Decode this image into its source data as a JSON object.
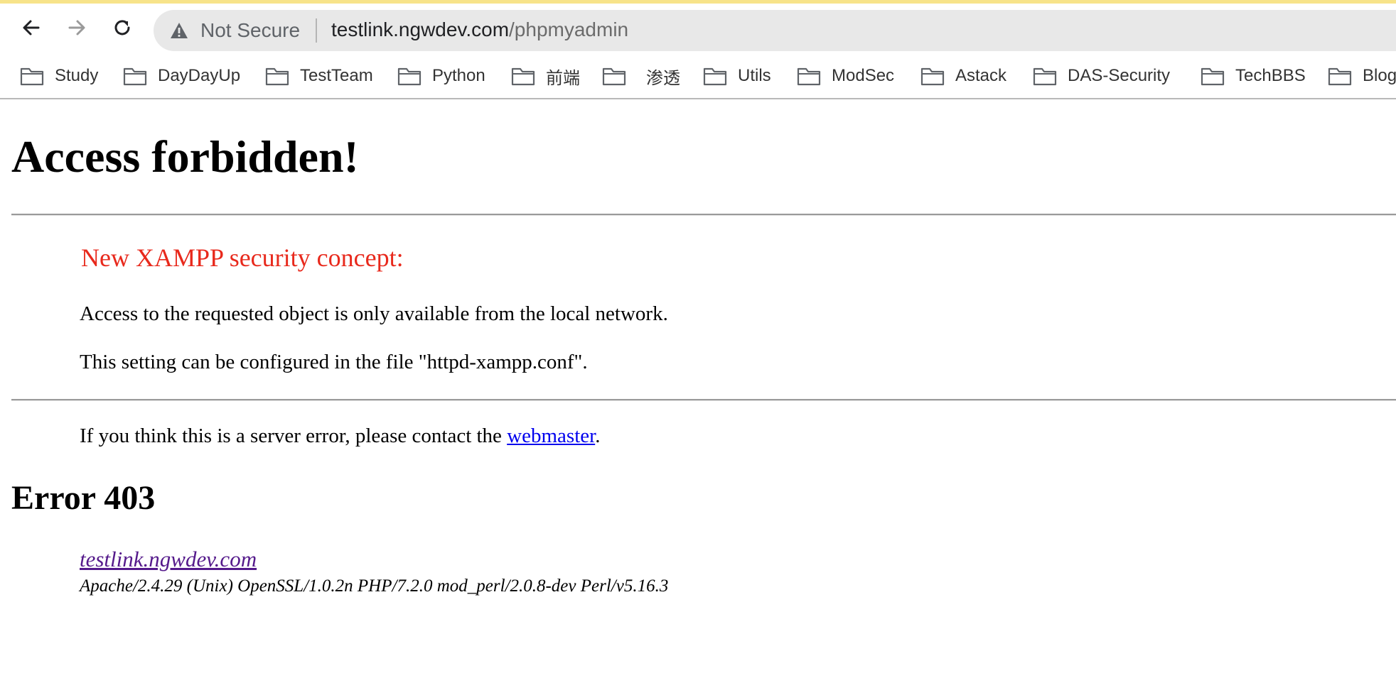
{
  "browser": {
    "security_label": "Not Secure",
    "url_host": "testlink.ngwdev.com",
    "url_path": "/phpmyadmin",
    "bookmarks": [
      {
        "label": "Study"
      },
      {
        "label": "DayDayUp"
      },
      {
        "label": "TestTeam"
      },
      {
        "label": "Python"
      },
      {
        "label": "前端"
      },
      {
        "label": "渗透"
      },
      {
        "label": "Utils"
      },
      {
        "label": "ModSec"
      },
      {
        "label": "Astack"
      },
      {
        "label": "DAS-Security"
      },
      {
        "label": "TechBBS"
      },
      {
        "label": "Blog"
      }
    ]
  },
  "page": {
    "title": "Access forbidden!",
    "concept_heading": "New XAMPP security concept:",
    "access_text": "Access to the requested object is only available from the local network.",
    "config_text": "This setting can be configured in the file \"httpd-xampp.conf\".",
    "contact_prefix": "If you think this is a server error, please contact the ",
    "contact_link": "webmaster",
    "contact_suffix": ".",
    "error_heading": "Error 403",
    "address_link": "testlink.ngwdev.com",
    "server_signature": "Apache/2.4.29 (Unix) OpenSSL/1.0.2n PHP/7.2.0 mod_perl/2.0.8-dev Perl/v5.16.3"
  },
  "colors": {
    "accent_strip": "#f7e38a",
    "concept_red": "#e8291c",
    "link_blue": "#0000ee",
    "visited_purple": "#551a8b"
  }
}
